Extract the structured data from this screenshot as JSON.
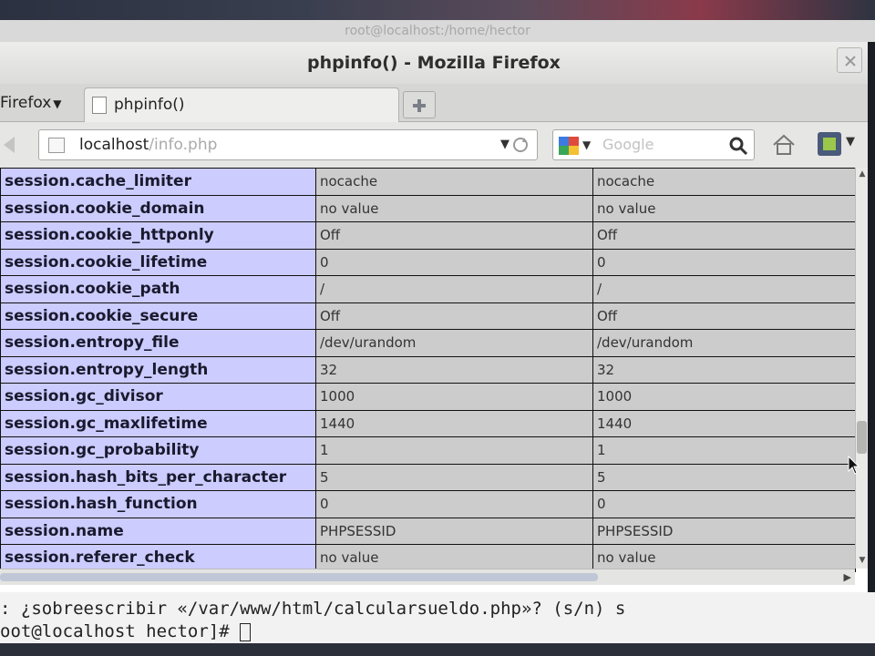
{
  "background_window_title": "root@localhost:/home/hector",
  "window": {
    "title": "phpinfo() - Mozilla Firefox"
  },
  "tabbar": {
    "firefox_menu_label": "Firefox",
    "tabs": [
      {
        "label": "phpinfo()"
      }
    ]
  },
  "navbar": {
    "url_host": "localhost",
    "url_path": "/info.php",
    "search_placeholder": "Google"
  },
  "table": {
    "rows": [
      {
        "key": "session.cache_limiter",
        "local": "nocache",
        "master": "nocache"
      },
      {
        "key": "session.cookie_domain",
        "local": "no value",
        "master": "no value"
      },
      {
        "key": "session.cookie_httponly",
        "local": "Off",
        "master": "Off"
      },
      {
        "key": "session.cookie_lifetime",
        "local": "0",
        "master": "0"
      },
      {
        "key": "session.cookie_path",
        "local": "/",
        "master": "/"
      },
      {
        "key": "session.cookie_secure",
        "local": "Off",
        "master": "Off"
      },
      {
        "key": "session.entropy_file",
        "local": "/dev/urandom",
        "master": "/dev/urandom"
      },
      {
        "key": "session.entropy_length",
        "local": "32",
        "master": "32"
      },
      {
        "key": "session.gc_divisor",
        "local": "1000",
        "master": "1000"
      },
      {
        "key": "session.gc_maxlifetime",
        "local": "1440",
        "master": "1440"
      },
      {
        "key": "session.gc_probability",
        "local": "1",
        "master": "1"
      },
      {
        "key": "session.hash_bits_per_character",
        "local": "5",
        "master": "5"
      },
      {
        "key": "session.hash_function",
        "local": "0",
        "master": "0"
      },
      {
        "key": "session.name",
        "local": "PHPSESSID",
        "master": "PHPSESSID"
      },
      {
        "key": "session.referer_check",
        "local": "no value",
        "master": "no value"
      }
    ]
  },
  "terminal": {
    "line1": ": ¿sobreescribir «/var/www/html/calcularsueldo.php»? (s/n) s",
    "line2": "oot@localhost hector]# "
  }
}
